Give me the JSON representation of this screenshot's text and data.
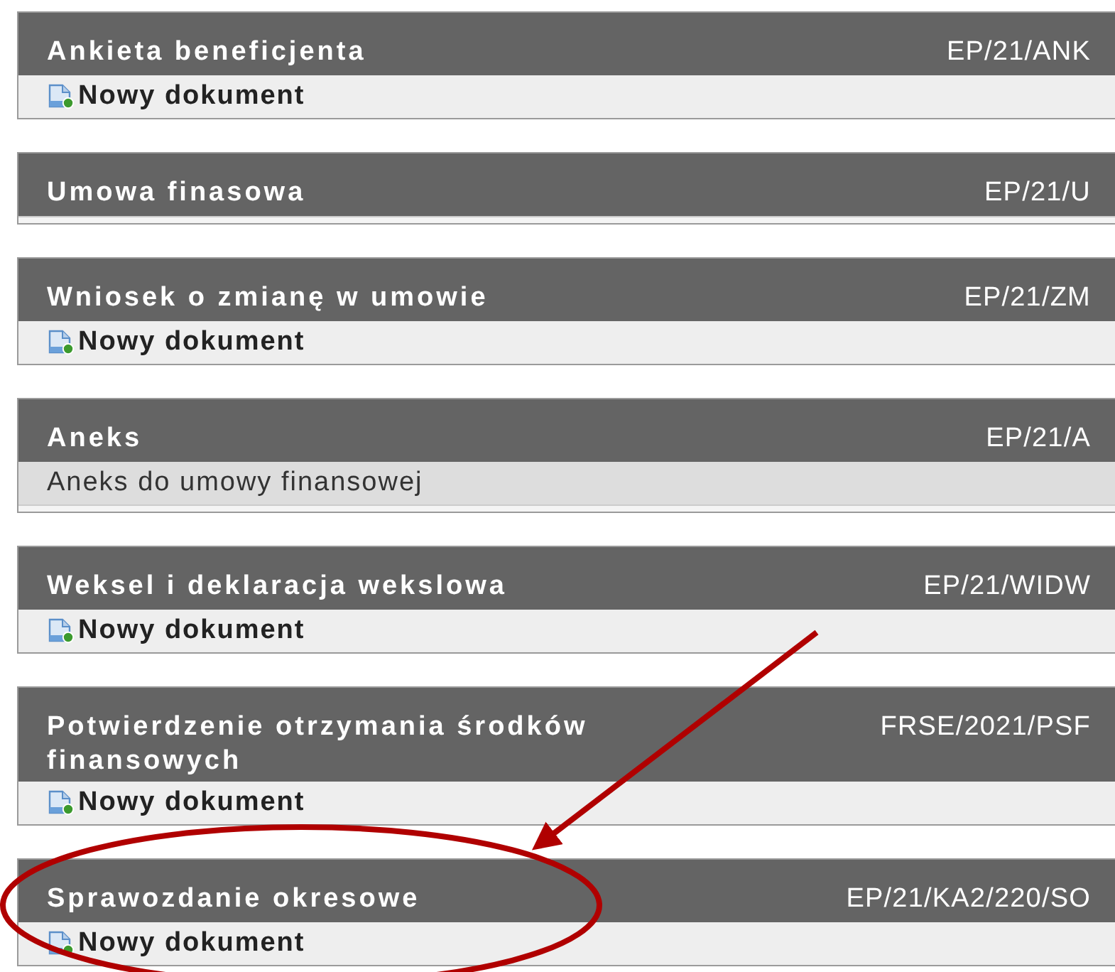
{
  "panels": [
    {
      "title": "Ankieta beneficjenta",
      "code": "EP/21/ANK",
      "kind": "action",
      "action": "Nowy dokument",
      "highlighted": false
    },
    {
      "title": "Umowa finasowa",
      "code": "EP/21/U",
      "kind": "empty",
      "highlighted": false
    },
    {
      "title": "Wniosek o zmianę w umowie",
      "code": "EP/21/ZM",
      "kind": "action",
      "action": "Nowy dokument",
      "highlighted": false
    },
    {
      "title": "Aneks",
      "code": "EP/21/A",
      "kind": "description",
      "description": "Aneks do umowy finansowej",
      "highlighted": false
    },
    {
      "title": "Weksel i deklaracja wekslowa",
      "code": "EP/21/WIDW",
      "kind": "action",
      "action": "Nowy dokument",
      "highlighted": false
    },
    {
      "title": "Potwierdzenie otrzymania środków finansowych",
      "code": "FRSE/2021/PSF",
      "kind": "action",
      "action": "Nowy dokument",
      "highlighted": false
    },
    {
      "title": "Sprawozdanie okresowe",
      "code": "EP/21/KA2/220/SO",
      "kind": "action",
      "action": "Nowy dokument",
      "highlighted": true
    }
  ]
}
